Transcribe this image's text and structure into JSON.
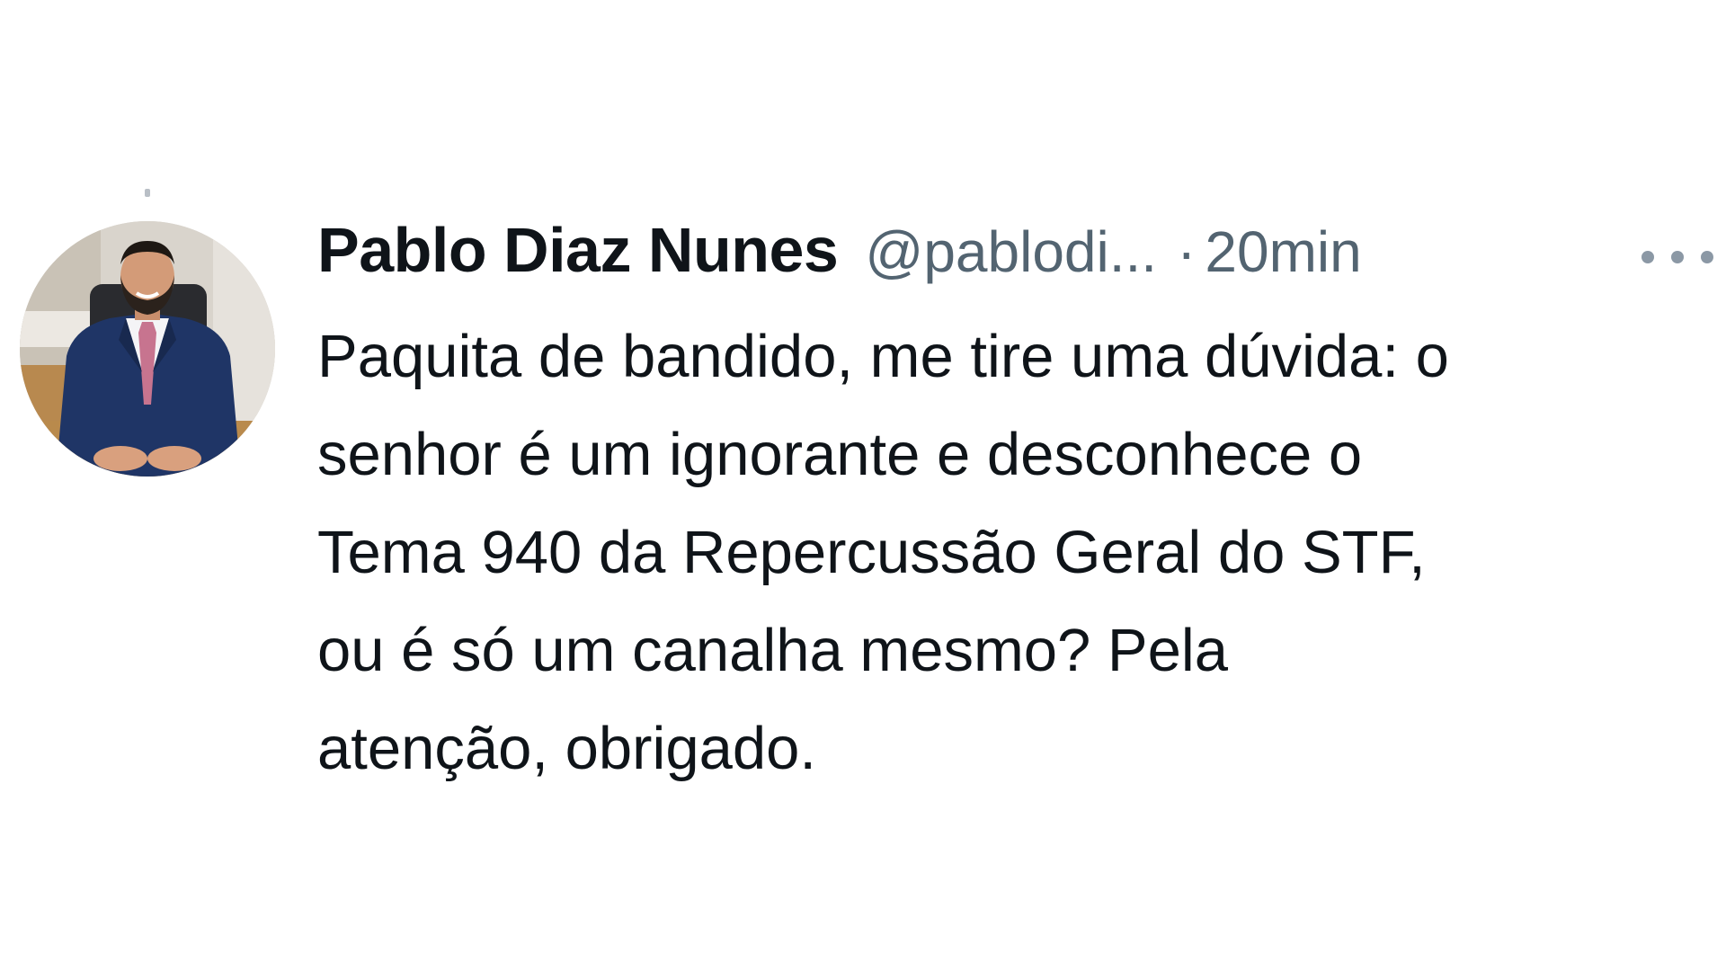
{
  "tweet": {
    "author_name": "Pablo Diaz Nunes",
    "handle": "@pablodi...",
    "separator": "·",
    "time": "20min",
    "lines": [
      "Paquita de bandido, me tire uma dúvida: o",
      "senhor é um ignorante e desconhece o",
      "Tema 940 da Repercussão Geral do STF,",
      "ou é só um canalha mesmo? Pela",
      "atenção, obrigado."
    ]
  },
  "icons": {
    "more": "more-horizontal-icon"
  },
  "colors": {
    "text_primary": "#0f1419",
    "text_secondary": "#536471",
    "background": "#ffffff"
  }
}
